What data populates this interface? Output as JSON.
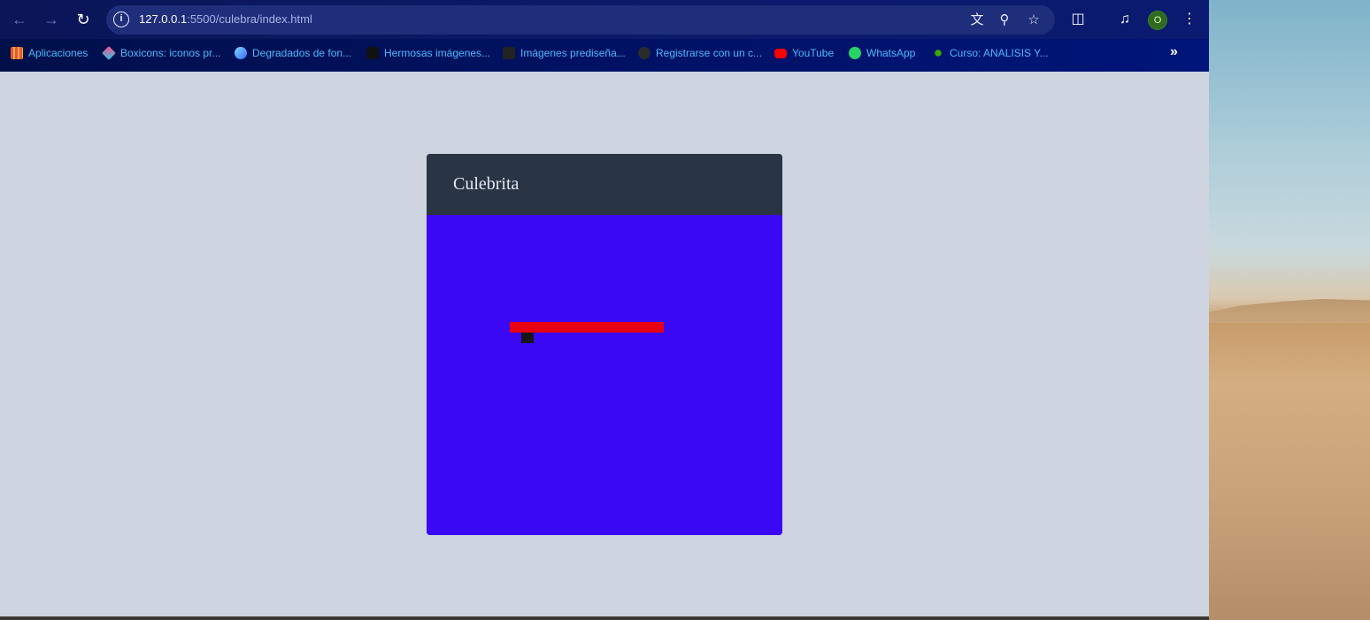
{
  "browser": {
    "url_host": "127.0.0.1",
    "url_rest": ":5500/culebra/index.html",
    "profile_initial": "O"
  },
  "bookmarks": [
    {
      "label": "Aplicaciones",
      "icon": "apps-grid-icon",
      "color": "#e8543c"
    },
    {
      "label": "Boxicons: iconos pr...",
      "icon": "boxicons-icon",
      "color": "#ff4f8b"
    },
    {
      "label": "Degradados de fon...",
      "icon": "gradient-icon",
      "color": "#3aa0ff"
    },
    {
      "label": "Hermosas imágenes...",
      "icon": "unsplash-icon",
      "color": "#111111"
    },
    {
      "label": "Imágenes prediseña...",
      "icon": "pngegg-icon",
      "color": "#222222"
    },
    {
      "label": "Registrarse con un c...",
      "icon": "angular-icon",
      "color": "#2b2b2b"
    },
    {
      "label": "YouTube",
      "icon": "youtube-icon",
      "color": "#ff0000"
    },
    {
      "label": "WhatsApp",
      "icon": "whatsapp-icon",
      "color": "#25d366"
    },
    {
      "label": "Curso: ANALISIS Y...",
      "icon": "sena-icon",
      "color": "#39a900"
    }
  ],
  "game": {
    "title": "Culebrita",
    "header_color": "#293444",
    "board_color": "#3b08f6",
    "snake_color": "#e60012",
    "food_color": "#16161a"
  }
}
